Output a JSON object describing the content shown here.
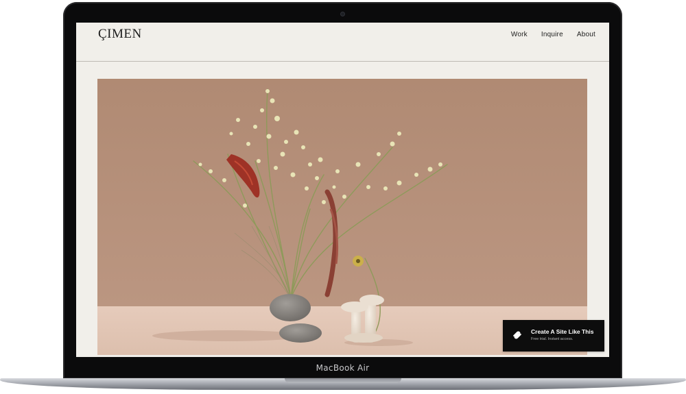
{
  "site": {
    "logo": "ÇIMEN",
    "nav": [
      "Work",
      "Inquire",
      "About"
    ]
  },
  "hero": {
    "image_icon": "flower-arrangement-photo",
    "colors": {
      "wall": "#b48f78",
      "floor": "#dfc3b2"
    }
  },
  "badge": {
    "title": "Create A Site Like This",
    "subtitle": "Free trial. Instant access.",
    "icon": "squarespace-logo-icon"
  },
  "device": {
    "label": "MacBook Air"
  },
  "colors": {
    "page_bg": "#f1efea",
    "text": "#1c1c1c",
    "badge_bg": "#0d0d0d",
    "bezel": "#0b0b0c"
  }
}
